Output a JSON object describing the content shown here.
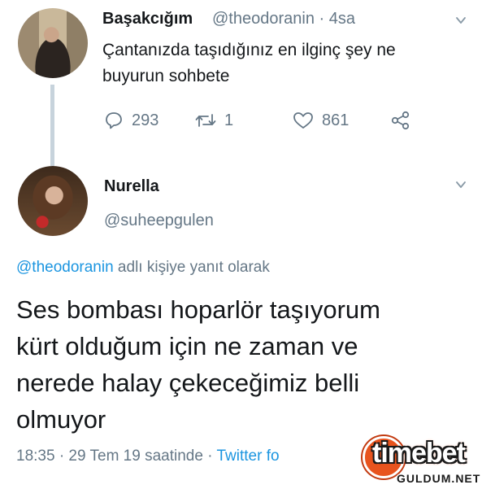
{
  "tweet1": {
    "name": "Başakcığım",
    "handle_time": "@theodoranin · 4sa",
    "text_line1": "Çantanızda taşıdığınız en ilginç şey ne",
    "text_line2": "buyurun sohbete",
    "actions": {
      "reply_icon": "reply-icon",
      "reply_count": "293",
      "retweet_icon": "retweet-icon",
      "retweet_count": "1",
      "like_icon": "heart-icon",
      "like_count": "861",
      "share_icon": "share-icon"
    }
  },
  "tweet2": {
    "name": "Nurella",
    "handle": "@suheepgulen",
    "replying_mention": "@theodoranin",
    "replying_text": " adlı kişiye yanıt olarak",
    "text_line1": "Ses bombası hoparlör taşıyorum",
    "text_line2": "kürt olduğum için ne zaman ve",
    "text_line3": "nerede halay çekeceğimiz belli",
    "text_line4": "olmuyor",
    "timestamp": "18:35 · 29 Tem 19 saatinde · ",
    "source": "Twitter fo"
  },
  "watermark": {
    "brand": "timebet",
    "site": "GULDUM.NET"
  },
  "colors": {
    "link": "#1b95e0",
    "secondary": "#657786",
    "primary_text": "#14171a",
    "thread_line": "#c7d3dc"
  }
}
